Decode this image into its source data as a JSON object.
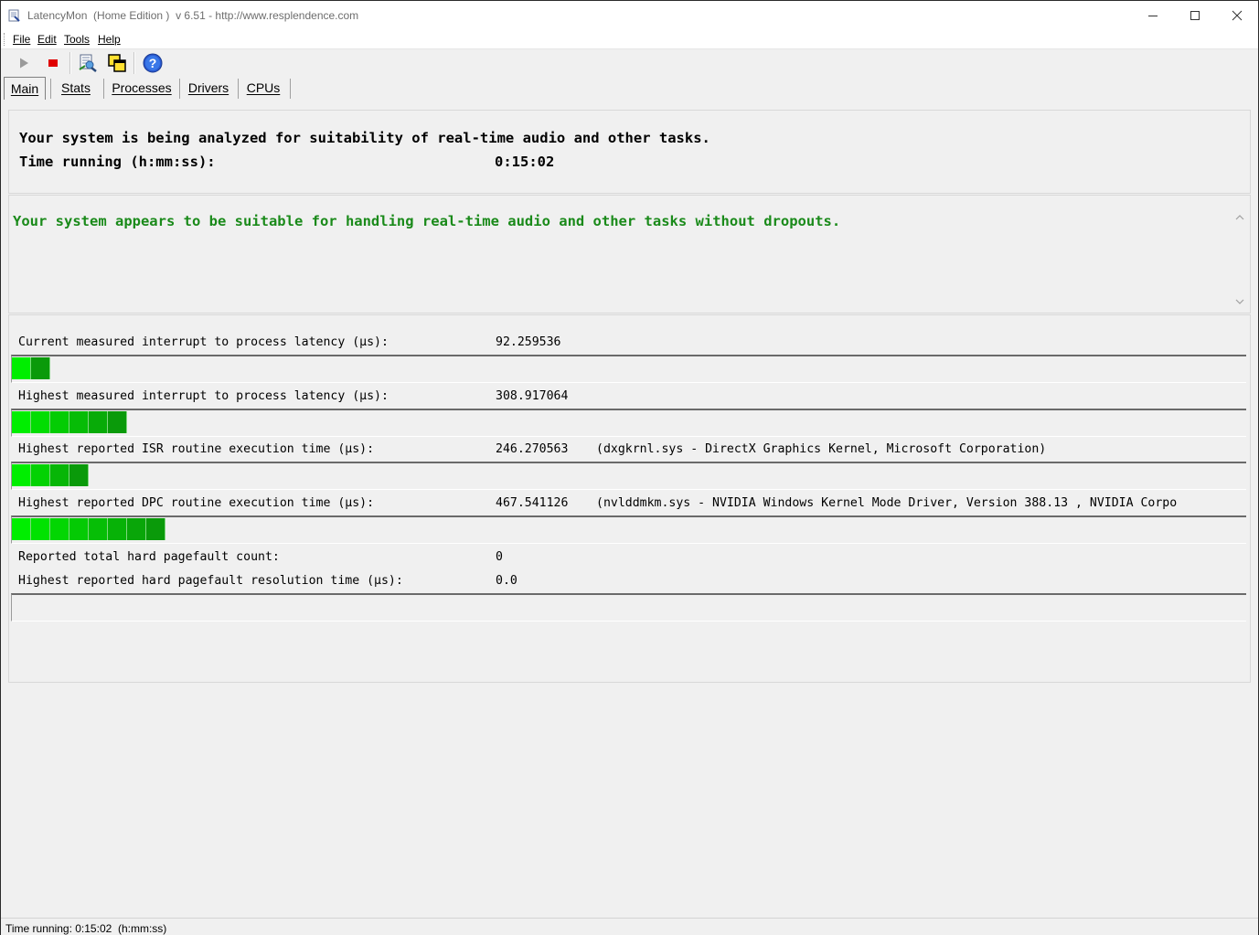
{
  "window": {
    "title": "LatencyMon  (Home Edition )  v 6.51 - http://www.resplendence.com"
  },
  "menu": [
    "File",
    "Edit",
    "Tools",
    "Help"
  ],
  "toolbar": {
    "icons": [
      "play-icon",
      "stop-icon",
      "report-icon",
      "windows-icon",
      "help-icon"
    ]
  },
  "tabs": [
    "Main",
    "Stats",
    "Processes",
    "Drivers",
    "CPUs"
  ],
  "active_tab": "Main",
  "main": {
    "headline": "Your system is being analyzed for suitability of real-time audio and other tasks.",
    "time_label": "Time running (h:mm:ss):",
    "time_value": "0:15:02",
    "verdict": "Your system appears to be suitable for handling real-time audio and other tasks without dropouts.",
    "verdict_color": "#1a8a1a"
  },
  "stats": [
    {
      "label": "Current measured interrupt to process latency (µs):",
      "value": "92.259536",
      "detail": "",
      "bar_segments": 2
    },
    {
      "label": "Highest measured interrupt to process latency (µs):",
      "value": "308.917064",
      "detail": "",
      "bar_segments": 6
    },
    {
      "label": "Highest reported ISR routine execution time (µs):",
      "value": "246.270563",
      "detail": "(dxgkrnl.sys - DirectX Graphics Kernel, Microsoft Corporation)",
      "bar_segments": 4
    },
    {
      "label": "Highest reported DPC routine execution time (µs):",
      "value": "467.541126",
      "detail": "(nvlddmkm.sys - NVIDIA Windows Kernel Mode Driver, Version 388.13 , NVIDIA Corpo",
      "bar_segments": 8
    },
    {
      "label": "Reported total hard pagefault count:",
      "value": "0",
      "detail": ""
    },
    {
      "label": "Highest reported hard pagefault resolution time (µs):",
      "value": "0.0",
      "detail": "",
      "bar_segments": 0
    }
  ],
  "statusbar": {
    "text": "Time running: 0:15:02  (h:mm:ss)"
  },
  "colors": {
    "bar_green_light": "#00ee00",
    "bar_green_dark": "#0a9a0a"
  }
}
